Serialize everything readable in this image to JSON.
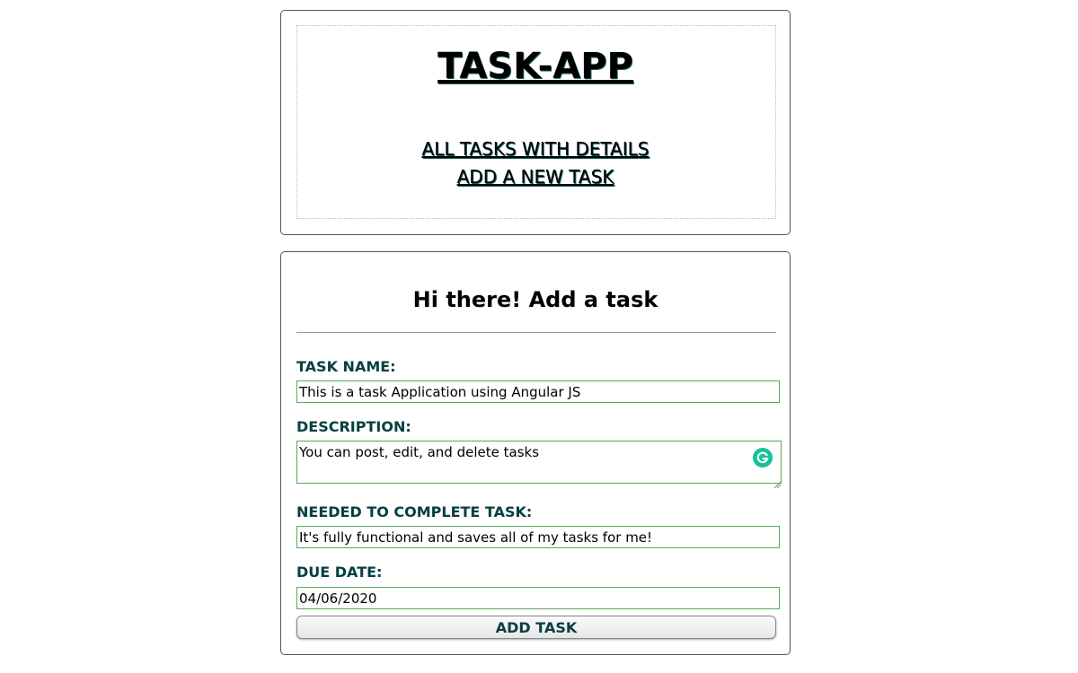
{
  "header": {
    "title": "TASK-APP",
    "nav": {
      "all_tasks": "ALL TASKS WITH DETAILS",
      "add_task": "ADD A NEW TASK"
    }
  },
  "form": {
    "heading": "Hi there! Add a task",
    "fields": {
      "task_name": {
        "label": "TASK NAME:",
        "value": "This is a task Application using Angular JS"
      },
      "description": {
        "label": "DESCRIPTION:",
        "value": "You can post, edit, and delete tasks"
      },
      "needed": {
        "label": "NEEDED TO COMPLETE TASK:",
        "value": "It's fully functional and saves all of my tasks for me!"
      },
      "due_date": {
        "label": "DUE DATE:",
        "value": "04/06/2020"
      }
    },
    "submit_label": "ADD TASK"
  },
  "colors": {
    "label_text": "#064040",
    "input_border": "#5aa85a",
    "grammarly_badge": "#15c39a"
  },
  "icons": {
    "grammarly": "grammarly-icon",
    "resize": "resize-grip-icon"
  }
}
